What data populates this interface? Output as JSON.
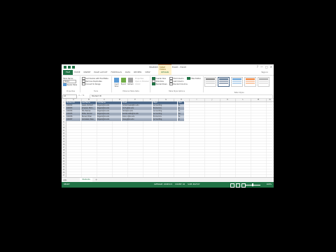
{
  "window": {
    "title": "Students - Microsoft Excel - Excel",
    "controls": [
      "?",
      "—",
      "□",
      "✕"
    ],
    "context_tab_group": "TABLE TOOLS"
  },
  "ribbon_tabs": {
    "file": "FILE",
    "items": [
      "HOME",
      "INSERT",
      "PAGE LAYOUT",
      "FORMULAS",
      "DATA",
      "REVIEW",
      "VIEW"
    ],
    "context_tab": "DESIGN",
    "signin": "Sign in"
  },
  "ribbon": {
    "properties": {
      "label": "Properties",
      "name_label": "Table Name:",
      "name_value": "Table1",
      "resize": "Resize Table"
    },
    "tools": {
      "label": "Tools",
      "items": [
        "Summarize with PivotTable",
        "Remove Duplicates",
        "Convert to Range"
      ]
    },
    "external": {
      "label": "External Table Data",
      "slicer": "Insert Slicer",
      "export": "Export",
      "refresh": "Refresh",
      "items": [
        "Properties",
        "Open in Browser",
        "Unlink"
      ]
    },
    "style_options": {
      "label": "Table Style Options",
      "items": [
        {
          "label": "Header Row",
          "checked": true
        },
        {
          "label": "Total Row",
          "checked": false
        },
        {
          "label": "Banded Rows",
          "checked": true
        },
        {
          "label": "First Column",
          "checked": false
        },
        {
          "label": "Last Column",
          "checked": false
        },
        {
          "label": "Banded Columns",
          "checked": false
        },
        {
          "label": "Filter Button",
          "checked": true
        }
      ]
    },
    "table_styles": {
      "label": "Table Styles",
      "swatches": [
        "#7f7f7f",
        "#4f6a8a",
        "#5b9bd5",
        "#ed7d31",
        "#a5a5a5"
      ]
    }
  },
  "formula_bar": {
    "name_box": "A1",
    "value": "Student ID"
  },
  "columns": [
    "A",
    "B",
    "C",
    "D",
    "E",
    "F",
    "G",
    "H",
    "I",
    "J",
    "K",
    "L",
    "M",
    "N"
  ],
  "rows": [
    "1",
    "2",
    "3",
    "4",
    "5",
    "6",
    "7",
    "8",
    "9",
    "10",
    "11",
    "12",
    "13",
    "14",
    "15",
    "16",
    "17",
    "18",
    "19",
    "20",
    "21",
    "22",
    "23",
    "24",
    "25",
    "26",
    "27"
  ],
  "table": {
    "headers": [
      "Student ID",
      "Last Name",
      "First Name",
      "Email",
      "Major",
      "Year"
    ],
    "rows": [
      [
        "100452",
        "Lewis, Richard",
        "Rogers@xx.edu",
        "richard.lewis@xx.edu",
        "Accounting",
        "Sr."
      ],
      [
        "100453",
        "Jimenez, Mich...",
        "Rogers@xx.edu",
        "mich.j@xx.edu",
        "Economics",
        "Jr."
      ],
      [
        "100454",
        "Hill, Barnes",
        "Rogers@xx.edu",
        "hill.b@xx.edu",
        "Accounting",
        "Fr."
      ],
      [
        "100455",
        "Willis, Kendal",
        "Rogers@xx.edu",
        "kendal.willis@xx.edu",
        "Accounting",
        "So."
      ],
      [
        "100456",
        "Nunez, Brian",
        "Rogers@xx.edu",
        "brian.n@xx.edu",
        "Economics",
        "Sr."
      ],
      [
        "100457",
        "Gonzalez, Rosa",
        "Rogers@xx.edu",
        "rosa.g@xx.edu",
        "Accounting",
        "Jr."
      ]
    ]
  },
  "sheets": {
    "active": "Students",
    "add": "+"
  },
  "status": {
    "ready": "READY",
    "average": "AVERAGE: 100454.5",
    "count": "COUNT: 42",
    "sum": "SUM: 602727",
    "zoom": "100%"
  }
}
